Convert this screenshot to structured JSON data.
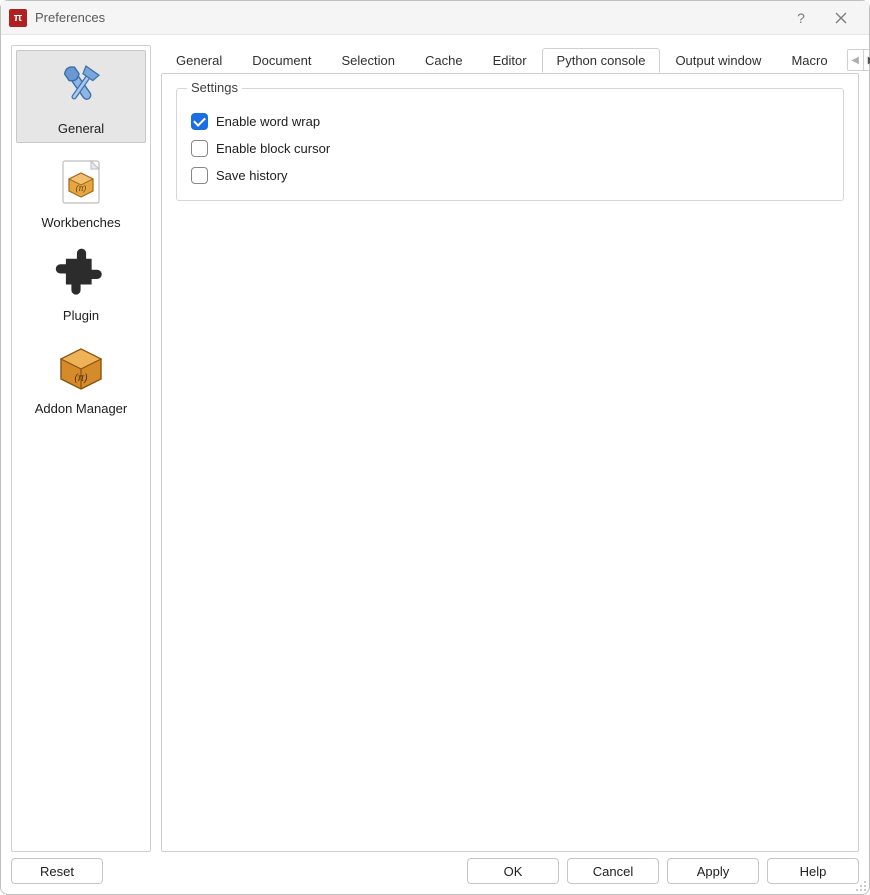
{
  "window": {
    "title": "Preferences",
    "app_icon_text": "π"
  },
  "sidebar": {
    "items": [
      {
        "label": "General",
        "icon": "tools-icon",
        "active": true
      },
      {
        "label": "Workbenches",
        "icon": "workbench-icon",
        "active": false
      },
      {
        "label": "Plugin",
        "icon": "plugin-icon",
        "active": false
      },
      {
        "label": "Addon Manager",
        "icon": "addon-icon",
        "active": false
      }
    ]
  },
  "tabs": {
    "items": [
      {
        "label": "General",
        "active": false
      },
      {
        "label": "Document",
        "active": false
      },
      {
        "label": "Selection",
        "active": false
      },
      {
        "label": "Cache",
        "active": false
      },
      {
        "label": "Editor",
        "active": false
      },
      {
        "label": "Python console",
        "active": true
      },
      {
        "label": "Output window",
        "active": false
      },
      {
        "label": "Macro",
        "active": false
      }
    ]
  },
  "panel": {
    "group_title": "Settings",
    "checkboxes": [
      {
        "label": "Enable word wrap",
        "checked": true
      },
      {
        "label": "Enable block cursor",
        "checked": false
      },
      {
        "label": "Save history",
        "checked": false
      }
    ]
  },
  "footer": {
    "reset": "Reset",
    "ok": "OK",
    "cancel": "Cancel",
    "apply": "Apply",
    "help": "Help"
  }
}
